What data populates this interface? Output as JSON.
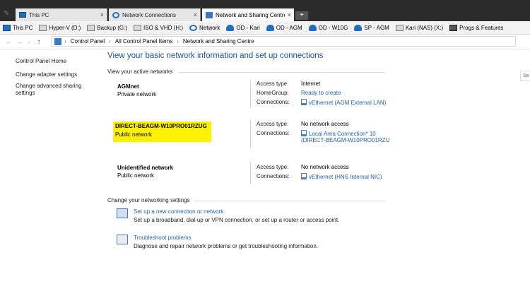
{
  "tabs": [
    {
      "label": "This PC",
      "active": false
    },
    {
      "label": "Network Connections",
      "active": false
    },
    {
      "label": "Network and Sharing Centre",
      "active": true
    }
  ],
  "favorites": [
    {
      "label": "This PC",
      "icon": "pc-icon"
    },
    {
      "label": "Hyper-V (D:)",
      "icon": "drive-icon"
    },
    {
      "label": "Backup (G:)",
      "icon": "drive-icon"
    },
    {
      "label": "ISO & VHD (H:)",
      "icon": "drive-icon"
    },
    {
      "label": "Network",
      "icon": "network-icon"
    },
    {
      "label": "OD - Kari",
      "icon": "onedrive-icon"
    },
    {
      "label": "OD - AGM",
      "icon": "onedrive-icon"
    },
    {
      "label": "OD - W10G",
      "icon": "onedrive-icon"
    },
    {
      "label": "SP - AGM",
      "icon": "onedrive-icon"
    },
    {
      "label": "Kari (NAS) (X:)",
      "icon": "nas-drive-icon"
    },
    {
      "label": "Progs & Features",
      "icon": "programs-icon"
    }
  ],
  "address": {
    "crumbs": [
      "Control Panel",
      "All Control Panel Items",
      "Network and Sharing Centre"
    ],
    "search_placeholder": "Se"
  },
  "sidebar": {
    "home": "Control Panel Home",
    "adapter": "Change adapter settings",
    "sharing_line1": "Change advanced sharing",
    "sharing_line2": "settings"
  },
  "main": {
    "title": "View your basic network information and set up connections",
    "active_heading": "View your active networks",
    "change_heading": "Change your networking settings"
  },
  "networks": [
    {
      "name": "AGMnet",
      "type": "Private network",
      "access_label": "Access type:",
      "access_value": "Internet",
      "homegroup_label": "HomeGroup:",
      "homegroup_value": "Ready to create",
      "connections_label": "Connections:",
      "connections_value": "vEthernet (AGM External LAN)"
    },
    {
      "name": "DIRECT-BEAGM-W10PRO01RZUG",
      "type": "Public network",
      "access_label": "Access type:",
      "access_value": "No network access",
      "connections_label": "Connections:",
      "connections_value_line1": "Local Area Connection* 10",
      "connections_value_line2": "(DIRECT-BEAGM-W10PRO01RZU"
    },
    {
      "name": "Unidentified network",
      "type": "Public network",
      "access_label": "Access type:",
      "access_value": "No network access",
      "connections_label": "Connections:",
      "connections_value": "vEthernet (HNS Internal NIC)"
    }
  ],
  "tasks": [
    {
      "title": "Set up a new connection or network",
      "desc": "Set up a broadband, dial-up or VPN connection, or set up a router or access point."
    },
    {
      "title": "Troubleshoot problems",
      "desc": "Diagnose and repair network problems or get troubleshooting information."
    }
  ],
  "colors": {
    "highlight": "#fef200",
    "link": "#1f5fa8",
    "title": "#1f4e9a"
  }
}
